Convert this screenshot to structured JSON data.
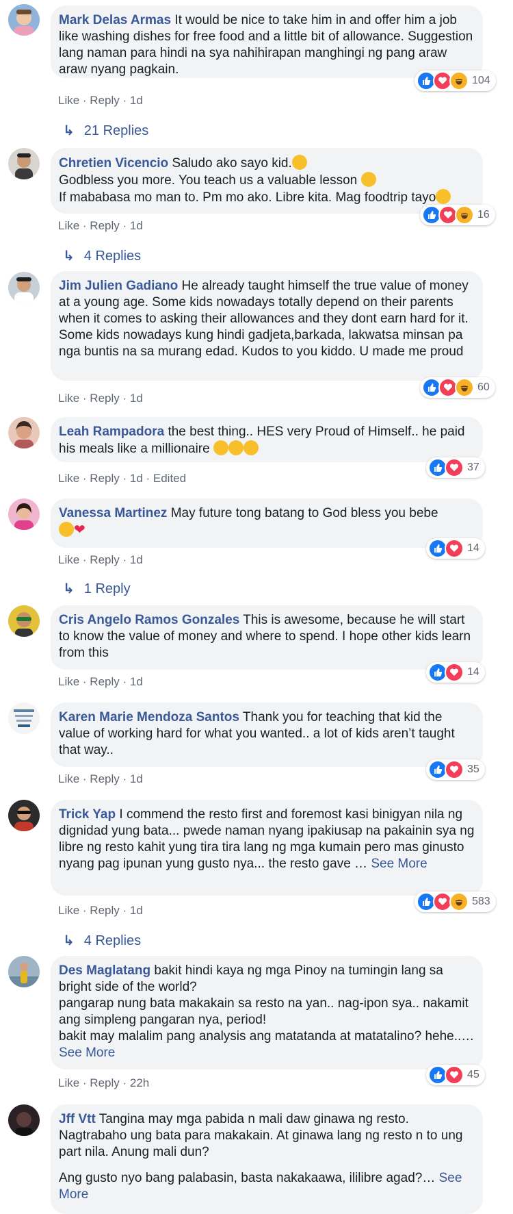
{
  "comments": [
    {
      "name": "Mark Delas Armas",
      "text": "It would be nice to take him in and offer him a job like washing dishes for free food and a little bit of allowance. Suggestion lang naman para hindi na sya nahihirapan manghingi ng pang araw araw nyang pagkain.",
      "actions": "Like · Reply · 1d",
      "reaction_count": "104",
      "replies": "21 Replies"
    },
    {
      "name": "Chretien Vicencio",
      "text_lines": [
        "Saludo ako sayo kid.",
        "Godbless you more. You teach us a valuable lesson",
        "If mababasa mo man to. Pm mo ako. Libre kita. Mag foodtrip tayo"
      ],
      "actions": "Like · Reply · 1d",
      "reaction_count": "16",
      "replies": "4 Replies"
    },
    {
      "name": "Jim Julien Gadiano",
      "text": "He already taught himself the true value of money at a young age. Some kids nowadays totally depend on their parents when it comes to asking their allowances and they dont earn hard for it. Some kids nowadays kung hindi gadjeta,barkada, lakwatsa minsan pa nga buntis na sa murang edad. Kudos to you kiddo. U made me proud",
      "actions": "Like · Reply · 1d",
      "reaction_count": "60"
    },
    {
      "name": "Leah Rampadora",
      "text": "the best thing.. HES very Proud of Himself.. he paid his meals like a millionaire",
      "actions": "Like · Reply · 1d · Edited",
      "reaction_count": "37"
    },
    {
      "name": "Vanessa Martinez",
      "text": "May future tong batang to God bless you bebe",
      "actions": "Like · Reply · 1d",
      "reaction_count": "14",
      "replies": "1 Reply"
    },
    {
      "name": "Cris Angelo Ramos Gonzales",
      "text": "This is awesome, because he will start to know the value of money and where to spend. I hope other kids learn from this",
      "actions": "Like · Reply · 1d",
      "reaction_count": "14"
    },
    {
      "name": "Karen Marie Mendoza Santos",
      "text": "Thank you for teaching that kid the value of working hard for what you wanted.. a lot of kids aren’t taught that way..",
      "actions": "Like · Reply · 1d",
      "reaction_count": "35"
    },
    {
      "name": "Trick Yap",
      "text": "I commend the resto first and foremost kasi binigyan nila ng dignidad yung bata... pwede naman nyang ipakiusap na pakainin sya ng libre ng resto kahit yung tira tira lang ng mga kumain pero mas ginusto nyang pag ipunan yung gusto nya... the resto gave …",
      "see_more": "See More",
      "actions": "Like · Reply · 1d",
      "reaction_count": "583",
      "replies": "4 Replies"
    },
    {
      "name": "Des Maglatang",
      "text_lines": [
        "bakit hindi kaya ng mga Pinoy na tumingin lang sa bright side of the world?",
        "pangarap nung bata makakain sa resto na yan.. nag-ipon sya.. nakamit ang simpleng pangaran nya, period!",
        "bakit may malalim pang analysis ang matatanda at matatalino? hehe..… "
      ],
      "see_more": "See More",
      "actions": "Like · Reply · 22h",
      "reaction_count": "45"
    },
    {
      "name": "Jff Vtt",
      "text_lines": [
        "Tangina may mga pabida n mali daw ginawa ng resto. Nagtrabaho ung bata para makakain. At ginawa lang ng resto n to ung part nila. Anung mali dun?",
        "Ang gusto nyo bang palabasin, basta nakakaawa, ililibre agad?… "
      ],
      "see_more": "See More"
    }
  ]
}
